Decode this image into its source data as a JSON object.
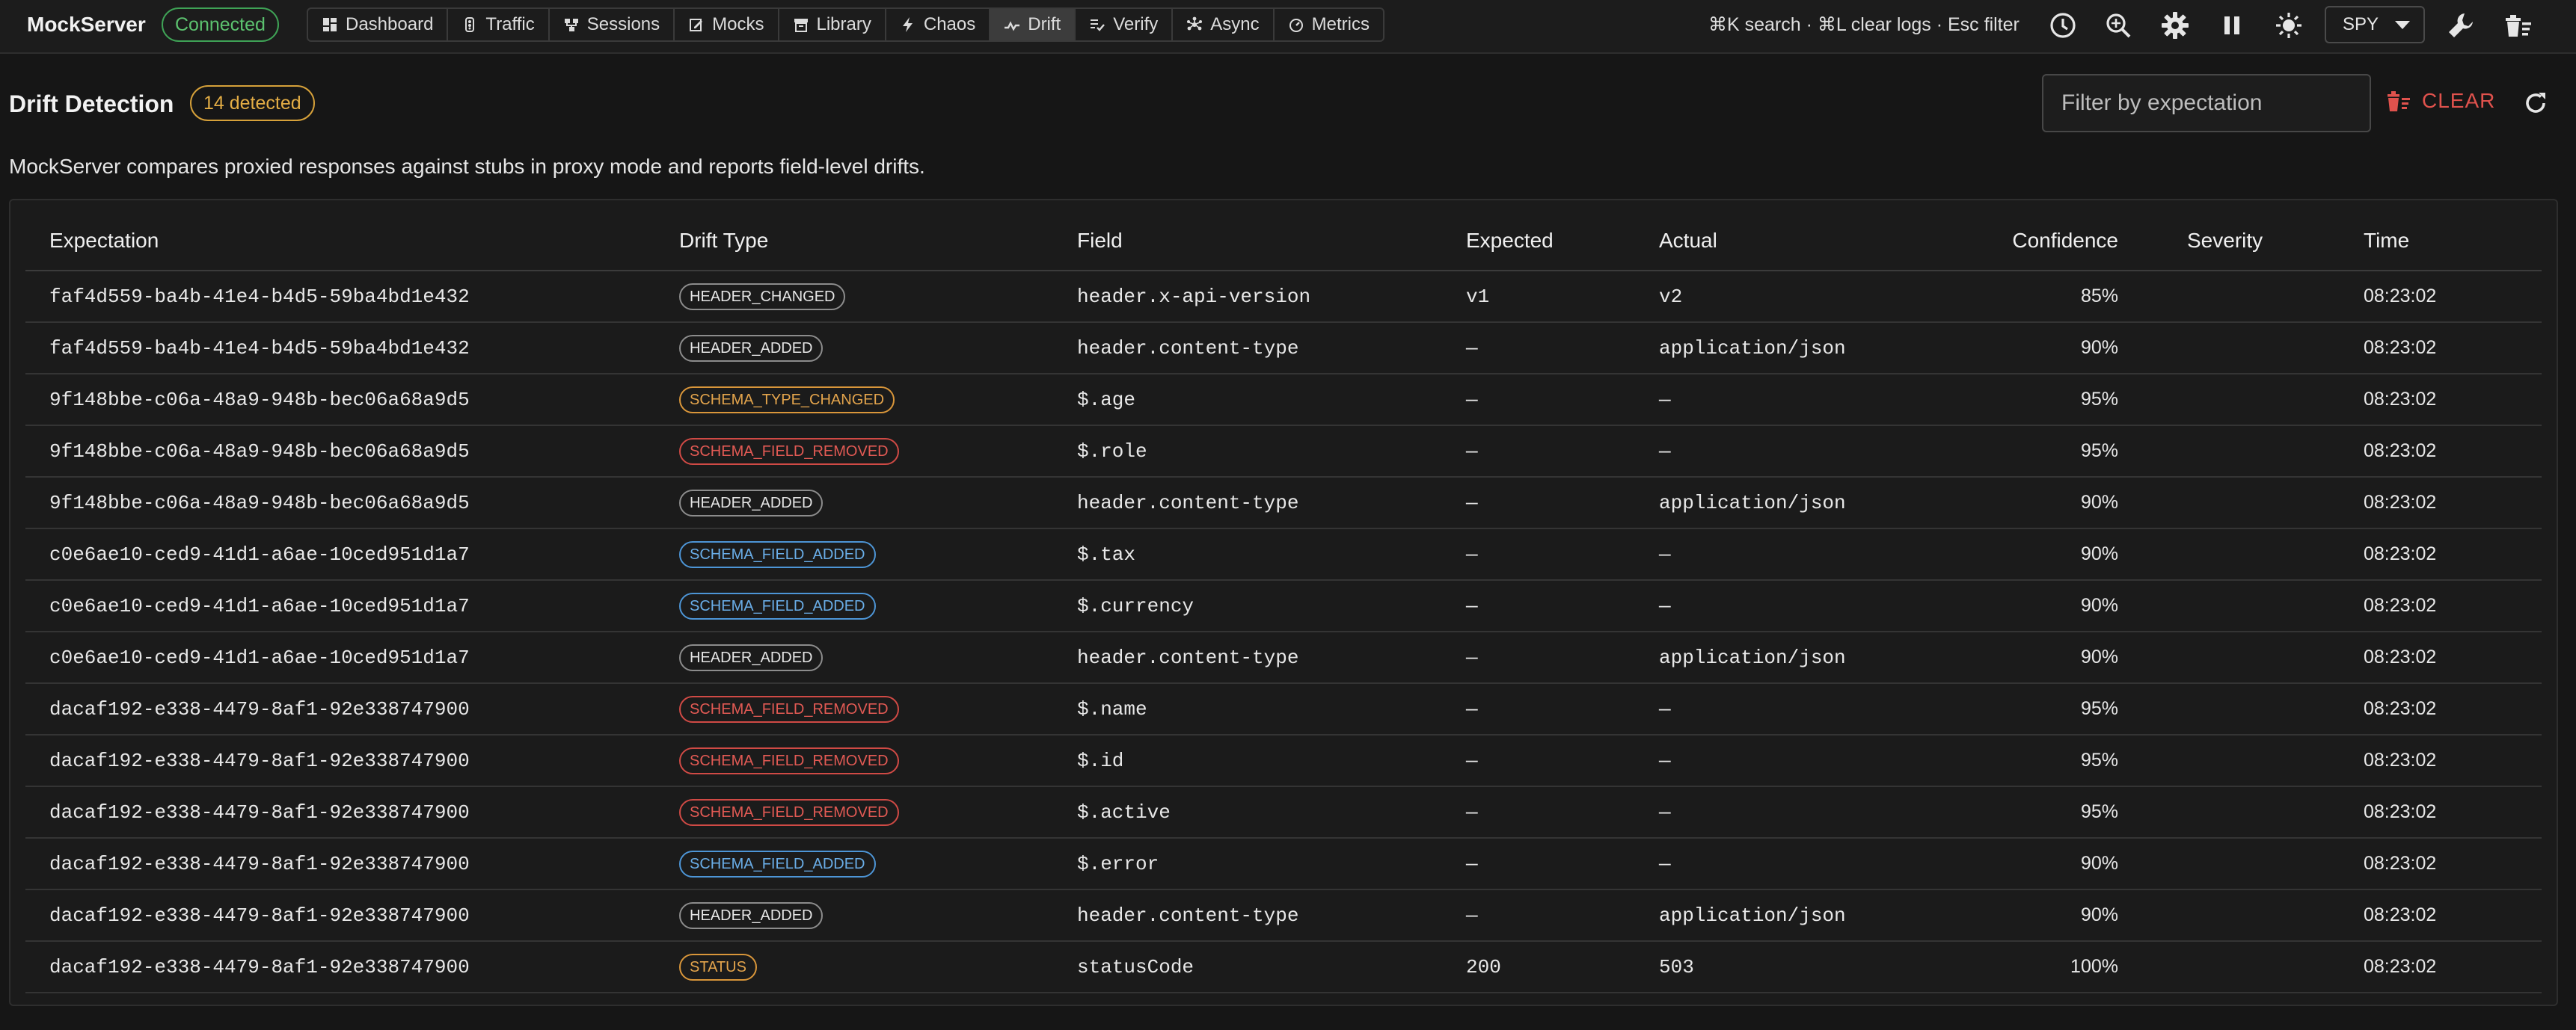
{
  "app": {
    "name": "MockServer",
    "status": "Connected"
  },
  "nav": [
    {
      "label": "Dashboard",
      "icon": "dashboard-icon",
      "active": false
    },
    {
      "label": "Traffic",
      "icon": "traffic-icon",
      "active": false
    },
    {
      "label": "Sessions",
      "icon": "sessions-icon",
      "active": false
    },
    {
      "label": "Mocks",
      "icon": "mocks-icon",
      "active": false
    },
    {
      "label": "Library",
      "icon": "library-icon",
      "active": false
    },
    {
      "label": "Chaos",
      "icon": "bolt-icon",
      "active": false
    },
    {
      "label": "Drift",
      "icon": "drift-icon",
      "active": true
    },
    {
      "label": "Verify",
      "icon": "verify-icon",
      "active": false
    },
    {
      "label": "Async",
      "icon": "async-icon",
      "active": false
    },
    {
      "label": "Metrics",
      "icon": "gauge-icon",
      "active": false
    }
  ],
  "toolbar": {
    "shortcuts": "⌘K search · ⌘L clear logs · Esc filter",
    "icons": [
      "history-icon",
      "zoom-search-icon",
      "gear-icon",
      "pause-icon",
      "theme-icon",
      "wrench-icon",
      "clear-all-icon"
    ],
    "mode": "SPY"
  },
  "header": {
    "title": "Drift Detection",
    "count_badge": "14 detected",
    "filter_placeholder": "Filter by expectation",
    "clear_label": "CLEAR",
    "description": "MockServer compares proxied responses against stubs in proxy mode and reports field-level drifts."
  },
  "table": {
    "columns": [
      "Expectation",
      "Drift Type",
      "Field",
      "Expected",
      "Actual",
      "Confidence",
      "Severity",
      "Time"
    ],
    "rows": [
      {
        "expectation": "faf4d559-ba4b-41e4-b4d5-59ba4bd1e432",
        "drift_type": "HEADER_CHANGED",
        "color": "grey",
        "field": "header.x-api-version",
        "expected": "v1",
        "actual": "v2",
        "confidence": "85%",
        "severity": "",
        "time": "08:23:02"
      },
      {
        "expectation": "faf4d559-ba4b-41e4-b4d5-59ba4bd1e432",
        "drift_type": "HEADER_ADDED",
        "color": "grey",
        "field": "header.content-type",
        "expected": "—",
        "actual": "application/json",
        "confidence": "90%",
        "severity": "",
        "time": "08:23:02"
      },
      {
        "expectation": "9f148bbe-c06a-48a9-948b-bec06a68a9d5",
        "drift_type": "SCHEMA_TYPE_CHANGED",
        "color": "orange",
        "field": "$.age",
        "expected": "—",
        "actual": "—",
        "confidence": "95%",
        "severity": "",
        "time": "08:23:02"
      },
      {
        "expectation": "9f148bbe-c06a-48a9-948b-bec06a68a9d5",
        "drift_type": "SCHEMA_FIELD_REMOVED",
        "color": "red",
        "field": "$.role",
        "expected": "—",
        "actual": "—",
        "confidence": "95%",
        "severity": "",
        "time": "08:23:02"
      },
      {
        "expectation": "9f148bbe-c06a-48a9-948b-bec06a68a9d5",
        "drift_type": "HEADER_ADDED",
        "color": "grey",
        "field": "header.content-type",
        "expected": "—",
        "actual": "application/json",
        "confidence": "90%",
        "severity": "",
        "time": "08:23:02"
      },
      {
        "expectation": "c0e6ae10-ced9-41d1-a6ae-10ced951d1a7",
        "drift_type": "SCHEMA_FIELD_ADDED",
        "color": "blue",
        "field": "$.tax",
        "expected": "—",
        "actual": "—",
        "confidence": "90%",
        "severity": "",
        "time": "08:23:02"
      },
      {
        "expectation": "c0e6ae10-ced9-41d1-a6ae-10ced951d1a7",
        "drift_type": "SCHEMA_FIELD_ADDED",
        "color": "blue",
        "field": "$.currency",
        "expected": "—",
        "actual": "—",
        "confidence": "90%",
        "severity": "",
        "time": "08:23:02"
      },
      {
        "expectation": "c0e6ae10-ced9-41d1-a6ae-10ced951d1a7",
        "drift_type": "HEADER_ADDED",
        "color": "grey",
        "field": "header.content-type",
        "expected": "—",
        "actual": "application/json",
        "confidence": "90%",
        "severity": "",
        "time": "08:23:02"
      },
      {
        "expectation": "dacaf192-e338-4479-8af1-92e338747900",
        "drift_type": "SCHEMA_FIELD_REMOVED",
        "color": "red",
        "field": "$.name",
        "expected": "—",
        "actual": "—",
        "confidence": "95%",
        "severity": "",
        "time": "08:23:02"
      },
      {
        "expectation": "dacaf192-e338-4479-8af1-92e338747900",
        "drift_type": "SCHEMA_FIELD_REMOVED",
        "color": "red",
        "field": "$.id",
        "expected": "—",
        "actual": "—",
        "confidence": "95%",
        "severity": "",
        "time": "08:23:02"
      },
      {
        "expectation": "dacaf192-e338-4479-8af1-92e338747900",
        "drift_type": "SCHEMA_FIELD_REMOVED",
        "color": "red",
        "field": "$.active",
        "expected": "—",
        "actual": "—",
        "confidence": "95%",
        "severity": "",
        "time": "08:23:02"
      },
      {
        "expectation": "dacaf192-e338-4479-8af1-92e338747900",
        "drift_type": "SCHEMA_FIELD_ADDED",
        "color": "blue",
        "field": "$.error",
        "expected": "—",
        "actual": "—",
        "confidence": "90%",
        "severity": "",
        "time": "08:23:02"
      },
      {
        "expectation": "dacaf192-e338-4479-8af1-92e338747900",
        "drift_type": "HEADER_ADDED",
        "color": "grey",
        "field": "header.content-type",
        "expected": "—",
        "actual": "application/json",
        "confidence": "90%",
        "severity": "",
        "time": "08:23:02"
      },
      {
        "expectation": "dacaf192-e338-4479-8af1-92e338747900",
        "drift_type": "STATUS",
        "color": "orange",
        "field": "statusCode",
        "expected": "200",
        "actual": "503",
        "confidence": "100%",
        "severity": "",
        "time": "08:23:02"
      }
    ]
  },
  "colors": {
    "background": "#161616",
    "connected": "#5cc26f",
    "badge": "#e3ad45",
    "clear": "#e0524d",
    "chip_grey": "#8c8c8c",
    "chip_orange": "#e3a44c",
    "chip_red": "#e25a54",
    "chip_blue": "#6aaee8"
  }
}
